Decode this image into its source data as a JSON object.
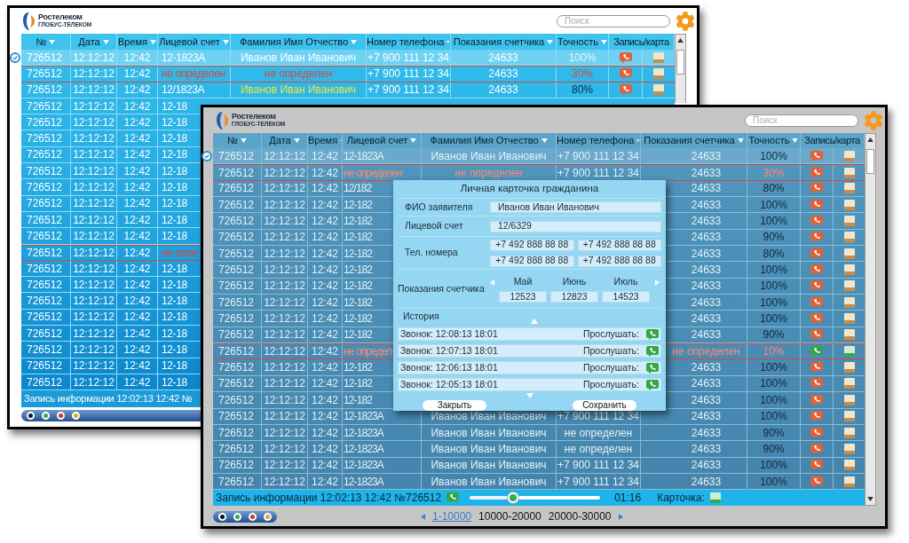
{
  "back_window": {
    "logo": {
      "name": "Ростелеком",
      "subtitle": "ГЛОБУС-ТЕЛЕКОМ"
    },
    "search": {
      "placeholder": "Поиск"
    },
    "columns": [
      "№",
      "Дата",
      "Время",
      "Лицевой счет",
      "Фамилия Имя Отчество",
      "Номер телефона",
      "Показания счетчика",
      "Точность",
      "Запись/карта"
    ],
    "rows": [
      {
        "number": "726512",
        "date": "12:12:12",
        "time": "12:42",
        "account": "12-1823А",
        "name": "Иванов Иван Иванович",
        "phone": "+7 900 111 12 34",
        "reading": "24633",
        "accuracy": "100%",
        "selected": true,
        "record_played": false
      },
      {
        "number": "726512",
        "date": "12:12:12",
        "time": "12:42",
        "account": "не определен",
        "name": "не определен",
        "phone": "+7 900 111 12 34",
        "reading": "24633",
        "accuracy": "30%",
        "selected": false,
        "flagged": true,
        "account_alert": true,
        "name_alert": true,
        "record_played": false
      },
      {
        "number": "726512",
        "date": "12:12:12",
        "time": "12:42",
        "account": "12/1823А",
        "name": "Иванов Иван Иванович",
        "phone": "+7 900 111 12 34",
        "reading": "24633",
        "accuracy": "80%",
        "selected": false,
        "name_highlighted": true,
        "record_played": false
      },
      {
        "number": "726512",
        "date": "12:12:12",
        "time": "12:42",
        "account": "12-18",
        "selected": false
      },
      {
        "number": "726512",
        "date": "12:12:12",
        "time": "12:42",
        "account": "12-18",
        "selected": false
      },
      {
        "number": "726512",
        "date": "12:12:12",
        "time": "12:42",
        "account": "12-18",
        "selected": false
      },
      {
        "number": "726512",
        "date": "12:12:12",
        "time": "12:42",
        "account": "12-18",
        "selected": false
      },
      {
        "number": "726512",
        "date": "12:12:12",
        "time": "12:42",
        "account": "12-18",
        "selected": false
      },
      {
        "number": "726512",
        "date": "12:12:12",
        "time": "12:42",
        "account": "12-18",
        "selected": false
      },
      {
        "number": "726512",
        "date": "12:12:12",
        "time": "12:42",
        "account": "12-18",
        "selected": false
      },
      {
        "number": "726512",
        "date": "12:12:12",
        "time": "12:42",
        "account": "12-18",
        "selected": false
      },
      {
        "number": "726512",
        "date": "12:12:12",
        "time": "12:42",
        "account": "12-18",
        "selected": false
      },
      {
        "number": "726512",
        "date": "12:12:12",
        "time": "12:42",
        "account": "не опре",
        "selected": false,
        "flagged": true,
        "account_alert": true
      },
      {
        "number": "726512",
        "date": "12:12:12",
        "time": "12:42",
        "account": "12-18",
        "selected": false
      },
      {
        "number": "726512",
        "date": "12:12:12",
        "time": "12:42",
        "account": "12-18",
        "selected": false
      },
      {
        "number": "726512",
        "date": "12:12:12",
        "time": "12:42",
        "account": "12-18",
        "selected": false
      },
      {
        "number": "726512",
        "date": "12:12:12",
        "time": "12:42",
        "account": "12-18",
        "selected": false
      },
      {
        "number": "726512",
        "date": "12:12:12",
        "time": "12:42",
        "account": "12-18",
        "selected": false
      },
      {
        "number": "726512",
        "date": "12:12:12",
        "time": "12:42",
        "account": "12-18",
        "selected": false
      },
      {
        "number": "726512",
        "date": "12:12:12",
        "time": "12:42",
        "account": "12-18",
        "selected": false
      },
      {
        "number": "726512",
        "date": "12:12:12",
        "time": "12:42",
        "account": "12-18",
        "selected": false
      }
    ],
    "status": "Запись информации 12:02:13 12:42 №",
    "theme_dots": [
      {
        "color": "#111111"
      },
      {
        "color": "#2fb34a"
      },
      {
        "color": "#d9302c"
      },
      {
        "color": "#e3a81c"
      }
    ]
  },
  "front_window": {
    "logo": {
      "name": "Ростелеком",
      "subtitle": "ГЛОБУС-ТЕЛЕКОМ"
    },
    "search": {
      "placeholder": "Поиск"
    },
    "columns": [
      "№",
      "Дата",
      "Время",
      "Лицевой счет",
      "Фамилия Имя Отчество",
      "Номер телефона",
      "Показания счетчика",
      "Точность",
      "Запись/карта"
    ],
    "rows": [
      {
        "number": "726512",
        "date": "12:12:12",
        "time": "12:42",
        "account": "12-1823А",
        "name": "Иванов Иван Иванович",
        "phone": "+7 900 111 12 34",
        "reading": "24633",
        "accuracy": "100%",
        "selected": true,
        "record_played": false
      },
      {
        "number": "726512",
        "date": "12:12:12",
        "time": "12:42",
        "account": "не определен",
        "name": "не определен",
        "phone": "+7 900 111 12 34",
        "reading": "24633",
        "accuracy": "30%",
        "selected": false,
        "flagged": true,
        "account_alert": true,
        "name_alert": true,
        "record_played": false
      },
      {
        "number": "726512",
        "date": "12:12:12",
        "time": "12:42",
        "account": "12/182",
        "reading": "24633",
        "accuracy": "80%",
        "selected": false,
        "record_played": false
      },
      {
        "number": "726512",
        "date": "12:12:12",
        "time": "12:42",
        "account": "12-182",
        "reading": "24633",
        "accuracy": "100%",
        "selected": false,
        "record_played": false
      },
      {
        "number": "726512",
        "date": "12:12:12",
        "time": "12:42",
        "account": "12-182",
        "reading": "24633",
        "accuracy": "100%",
        "selected": false,
        "record_played": false
      },
      {
        "number": "726512",
        "date": "12:12:12",
        "time": "12:42",
        "account": "12-182",
        "reading": "24633",
        "accuracy": "90%",
        "selected": false,
        "record_played": false
      },
      {
        "number": "726512",
        "date": "12:12:12",
        "time": "12:42",
        "account": "12-182",
        "reading": "24633",
        "accuracy": "80%",
        "selected": false,
        "record_played": false
      },
      {
        "number": "726512",
        "date": "12:12:12",
        "time": "12:42",
        "account": "12-182",
        "reading": "24633",
        "accuracy": "100%",
        "selected": false,
        "record_played": false
      },
      {
        "number": "726512",
        "date": "12:12:12",
        "time": "12:42",
        "account": "12-182",
        "reading": "24633",
        "accuracy": "100%",
        "selected": false,
        "record_played": false
      },
      {
        "number": "726512",
        "date": "12:12:12",
        "time": "12:42",
        "account": "12-182",
        "reading": "24633",
        "accuracy": "100%",
        "selected": false,
        "record_played": false
      },
      {
        "number": "726512",
        "date": "12:12:12",
        "time": "12:42",
        "account": "12-182",
        "reading": "24633",
        "accuracy": "100%",
        "selected": false,
        "record_played": false
      },
      {
        "number": "726512",
        "date": "12:12:12",
        "time": "12:42",
        "account": "12-182",
        "reading": "24633",
        "accuracy": "90%",
        "selected": false,
        "record_played": false
      },
      {
        "number": "726512",
        "date": "12:12:12",
        "time": "12:42",
        "account": "не определ",
        "reading": "не определен",
        "accuracy": "10%",
        "selected": false,
        "flagged": true,
        "account_alert": true,
        "reading_alert": true,
        "record_played": true
      },
      {
        "number": "726512",
        "date": "12:12:12",
        "time": "12:42",
        "account": "12-182",
        "reading": "24633",
        "accuracy": "100%",
        "selected": false,
        "record_played": false
      },
      {
        "number": "726512",
        "date": "12:12:12",
        "time": "12:42",
        "account": "12-182",
        "reading": "24633",
        "accuracy": "100%",
        "selected": false,
        "record_played": false
      },
      {
        "number": "726512",
        "date": "12:12:12",
        "time": "12:42",
        "account": "12-182",
        "reading": "24633",
        "accuracy": "100%",
        "selected": false,
        "record_played": false
      },
      {
        "number": "726512",
        "date": "12:12:12",
        "time": "12:42",
        "account": "12-1823А",
        "name": "Иванов Иван Иванович",
        "phone": "+7 900 111 12 34",
        "reading": "24633",
        "accuracy": "100%",
        "selected": false,
        "record_played": false
      },
      {
        "number": "726512",
        "date": "12:12:12",
        "time": "12:42",
        "account": "12-1823А",
        "name": "Иванов Иван Иванович",
        "phone": "не определен",
        "reading": "24633",
        "accuracy": "90%",
        "selected": false,
        "record_played": false
      },
      {
        "number": "726512",
        "date": "12:12:12",
        "time": "12:42",
        "account": "12-1823А",
        "name": "Иванов Иван Иванович",
        "phone": "не определен",
        "reading": "24633",
        "accuracy": "90%",
        "selected": false,
        "record_played": false
      },
      {
        "number": "726512",
        "date": "12:12:12",
        "time": "12:42",
        "account": "12-1823А",
        "name": "Иванов Иван Иванович",
        "phone": "+7 900 111 12 34",
        "reading": "24633",
        "accuracy": "100%",
        "selected": false,
        "record_played": false
      },
      {
        "number": "726512",
        "date": "12:12:12",
        "time": "12:42",
        "account": "12-1823А",
        "name": "Иванов Иван Иванович",
        "phone": "+7 900 111 12 34",
        "reading": "24633",
        "accuracy": "100%",
        "selected": false,
        "record_played": false
      }
    ],
    "player": {
      "text": "Запись информации 12:02:13 12:42 №726512",
      "level": 0.33,
      "time": "01:16",
      "card_label": "Карточка:"
    },
    "pagination": [
      {
        "label": "1-10000",
        "selected": true
      },
      {
        "label": "10000-20000",
        "selected": false
      },
      {
        "label": "20000-30000",
        "selected": false
      }
    ],
    "theme_dots": [
      {
        "color": "#111111"
      },
      {
        "color": "#2fb34a"
      },
      {
        "color": "#d9302c"
      },
      {
        "color": "#e3a81c"
      }
    ]
  },
  "dialog": {
    "title": "Личная карточка гражданина",
    "fields": [
      {
        "label": "ФИО заявителя",
        "values": [
          "Иванов Иван Иванович"
        ]
      },
      {
        "label": "Лицевой счет",
        "values": [
          "12/6329"
        ]
      },
      {
        "label": "Тел. номера",
        "values": [
          "+7 492 888 88 88",
          "+7 492 888 88 88",
          "+7 492 888 88 88",
          "+7 492 888 88 88"
        ]
      }
    ],
    "readings": {
      "label": "Показания счетчика",
      "months": [
        {
          "month": "Май",
          "value": "12523"
        },
        {
          "month": "Июнь",
          "value": "12823"
        },
        {
          "month": "Июль",
          "value": "14523"
        }
      ]
    },
    "history": {
      "label": "История",
      "items": [
        {
          "text": "Звонок: 12:08:13 18:01",
          "action": "Прослушать:"
        },
        {
          "text": "Звонок: 12:07:13 18:01",
          "action": "Прослушать:"
        },
        {
          "text": "Звонок: 12:06:13 18:01",
          "action": "Прослушать:"
        },
        {
          "text": "Звонок: 12:05:13 18:01",
          "action": "Прослушать:"
        }
      ]
    },
    "buttons": [
      "Закрыть",
      "Сохранить"
    ]
  }
}
